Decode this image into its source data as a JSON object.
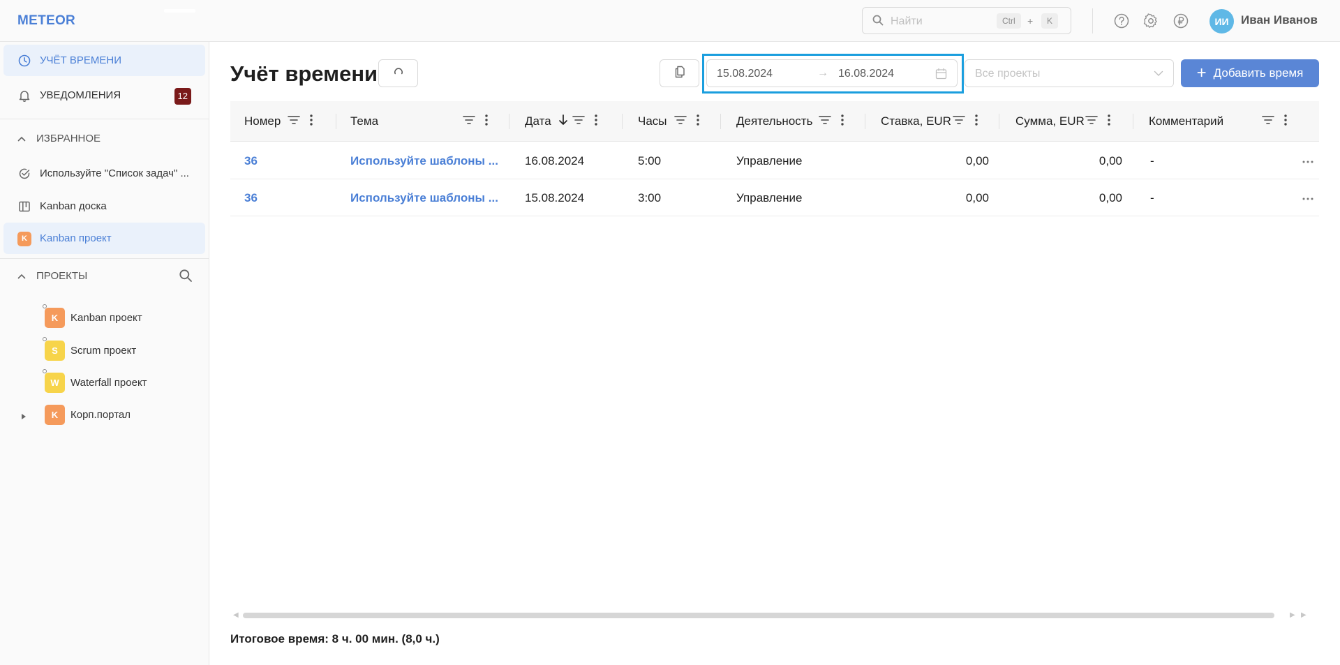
{
  "app": {
    "logo": "METEOR"
  },
  "topbar": {
    "search_placeholder": "Найти",
    "kbd_ctrl": "Ctrl",
    "kbd_plus": "+",
    "kbd_key": "K",
    "user_initials": "ИИ",
    "user_name": "Иван Иванов"
  },
  "sidebar": {
    "time_tracking": "Учёт времени",
    "notifications": "Уведомления",
    "notifications_count": "12",
    "favorites_title": "Избранное",
    "favorites": [
      {
        "label": "Используйте \"Список задач\" ...",
        "icon": "check-circle-icon"
      },
      {
        "label": "Kanban доска",
        "icon": "kanban-board-icon"
      },
      {
        "label": "Kanban проект",
        "badge": "K",
        "badge_color": "#f59a5b"
      }
    ],
    "projects_title": "Проекты",
    "projects": [
      {
        "label": "Kanban проект",
        "badge": "K",
        "badge_color": "#f59a5b"
      },
      {
        "label": "Scrum проект",
        "badge": "S",
        "badge_color": "#f7d44a"
      },
      {
        "label": "Waterfall проект",
        "badge": "W",
        "badge_color": "#f7d44a"
      },
      {
        "label": "Корп.портал",
        "badge": "K",
        "badge_color": "#f59a5b"
      }
    ]
  },
  "main": {
    "title": "Учёт времени",
    "date_from": "15.08.2024",
    "date_arrow": "→",
    "date_to": "16.08.2024",
    "projects_placeholder": "Все проекты",
    "add_button": "Добавить время"
  },
  "table": {
    "columns": [
      "Номер",
      "Тема",
      "Дата",
      "Часы",
      "Деятельность",
      "Ставка, EUR",
      "Сумма, EUR",
      "Комментарий"
    ],
    "rows": [
      {
        "number": "36",
        "topic": "Используйте шаблоны ...",
        "date": "16.08.2024",
        "hours": "5:00",
        "activity": "Управление",
        "rate": "0,00",
        "sum": "0,00",
        "comment": "-"
      },
      {
        "number": "36",
        "topic": "Используйте шаблоны ...",
        "date": "15.08.2024",
        "hours": "3:00",
        "activity": "Управление",
        "rate": "0,00",
        "sum": "0,00",
        "comment": "-"
      }
    ]
  },
  "footer": {
    "total": "Итоговое время: 8 ч. 00 мин. (8,0 ч.)"
  },
  "colors": {
    "accent": "#4a7fd6",
    "primary_button": "#5a86d6",
    "highlight_border": "#1a9ede",
    "badge_bg": "#7a1a1a"
  }
}
